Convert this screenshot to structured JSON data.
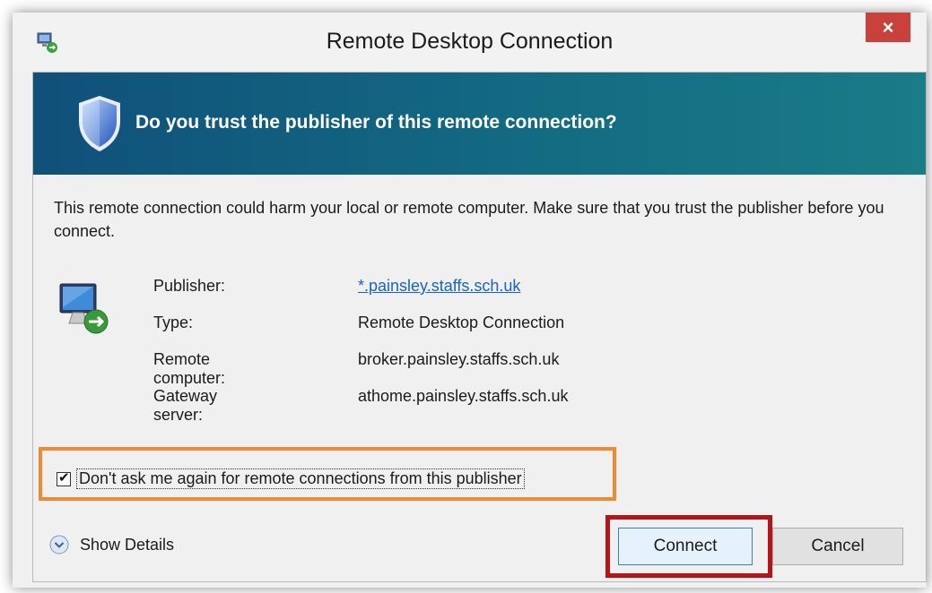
{
  "window": {
    "title": "Remote Desktop Connection",
    "close_label": "×"
  },
  "banner": {
    "text": "Do you trust the publisher of this remote connection?"
  },
  "warning": {
    "text": "This remote connection could harm your local or remote computer. Make sure that you trust the publisher before you connect."
  },
  "details": [
    {
      "label": "Publisher:",
      "value": "*.painsley.staffs.sch.uk"
    },
    {
      "label": "Type:",
      "value": "Remote Desktop Connection"
    },
    {
      "label": "Remote computer:",
      "value": "broker.painsley.staffs.sch.uk"
    },
    {
      "label": "Gateway server:",
      "value": "athome.painsley.staffs.sch.uk"
    }
  ],
  "checkbox": {
    "checked": true,
    "check_mark": "✔",
    "label": "Don't ask me again for remote connections from this publisher"
  },
  "show_details": {
    "label": "Show Details"
  },
  "buttons": {
    "connect": "Connect",
    "cancel": "Cancel"
  },
  "colors": {
    "banner_start": "#10507a",
    "banner_end": "#1a7c87",
    "close": "#c8413b",
    "link": "#1763c6",
    "checkbox_highlight": "#ef8a32",
    "connect_highlight": "#b4151a"
  },
  "icons": {
    "app": "remote-desktop-icon",
    "banner": "shield-icon",
    "details": "computer-connection-icon",
    "show_details": "chevron-down-circle-icon"
  }
}
